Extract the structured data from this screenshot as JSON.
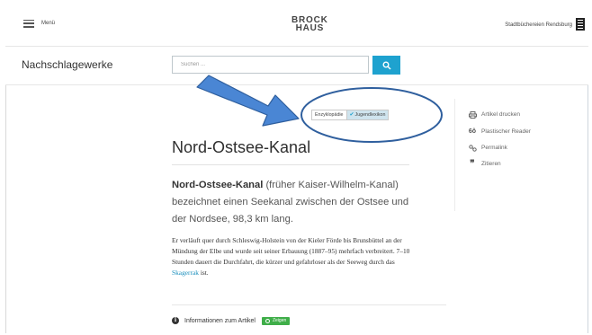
{
  "header": {
    "menu_label": "Menü",
    "logo_line1": "BROCK",
    "logo_line2": "HAUS",
    "library_name": "Stadtbüchereien Rendsburg"
  },
  "subheader": {
    "section_title": "Nachschlagewerke",
    "search_placeholder": "Suchen ..."
  },
  "toggle": {
    "option1": "Enzyklopädie",
    "option2": "Jugendlexikon",
    "active": "Jugendlexikon"
  },
  "article": {
    "title": "Nord-Ostsee-Kanal",
    "lead_term": "Nord-Ostsee-Kanal",
    "lead_rest": " (früher Kaiser-Wilhelm-Kanal) bezeichnet einen Seekanal zwischen der Ostsee und der Nordsee, 98,3 km lang.",
    "body_before_link": "Er verläuft quer durch Schleswig-Holstein von der Kieler Förde bis Brunsbüttel an der Mündung der Elbe und wurde seit seiner Erbauung (1887–95) mehrfach verbreitert. 7–10 Stunden dauert die Durchfahrt, die kürzer und gefahrloser als der Seeweg durch das ",
    "body_link": "Skagerrak",
    "body_after_link": " ist.",
    "info_label": "Informationen zum Artikel",
    "show_label": "Zeigen"
  },
  "side_actions": [
    {
      "icon": "printer-icon",
      "label": "Artikel drucken"
    },
    {
      "icon": "reader-glasses-icon",
      "label": "Plastischer Reader"
    },
    {
      "icon": "permalink-icon",
      "label": "Permalink"
    },
    {
      "icon": "quote-icon",
      "label": "Zitieren"
    }
  ],
  "colors": {
    "accent": "#1ea2cf",
    "show_button": "#3fae49",
    "annotation_arrow": "#4a86d4",
    "annotation_ellipse": "#2f5f9e"
  }
}
